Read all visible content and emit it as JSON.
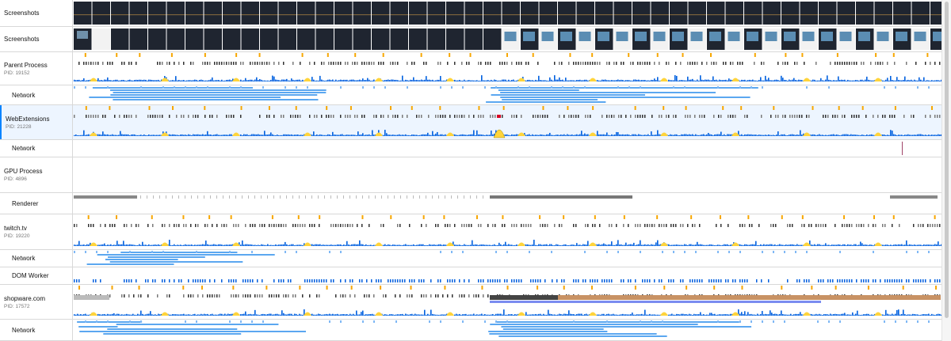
{
  "tracks": [
    {
      "id": "screenshots-1",
      "name": "Screenshots",
      "pid": "",
      "kind": "screenshots",
      "local": false,
      "selected": false
    },
    {
      "id": "screenshots-2",
      "name": "Screenshots",
      "pid": "",
      "kind": "screenshots2",
      "local": false,
      "selected": false
    },
    {
      "id": "parent-process",
      "name": "Parent Process",
      "pid": "PID: 19152",
      "kind": "process",
      "local": false,
      "selected": false
    },
    {
      "id": "parent-network",
      "name": "Network",
      "pid": "",
      "kind": "network",
      "local": true,
      "selected": false
    },
    {
      "id": "webextensions",
      "name": "WebExtensions",
      "pid": "PID: 21228",
      "kind": "process",
      "local": false,
      "selected": true
    },
    {
      "id": "webext-network",
      "name": "Network",
      "pid": "",
      "kind": "network-empty",
      "local": true,
      "selected": false
    },
    {
      "id": "gpu-process",
      "name": "GPU Process",
      "pid": "PID: 4896",
      "kind": "empty",
      "local": false,
      "selected": false
    },
    {
      "id": "gpu-renderer",
      "name": "Renderer",
      "pid": "",
      "kind": "renderer",
      "local": true,
      "selected": false
    },
    {
      "id": "twitch",
      "name": "twitch.tv",
      "pid": "PID: 19220",
      "kind": "process",
      "local": false,
      "selected": false
    },
    {
      "id": "twitch-network",
      "name": "Network",
      "pid": "",
      "kind": "network-small",
      "local": true,
      "selected": false
    },
    {
      "id": "twitch-dom-worker",
      "name": "DOM Worker",
      "pid": "",
      "kind": "worker",
      "local": true,
      "selected": false
    },
    {
      "id": "shopware",
      "name": "shopware.com",
      "pid": "PID: 17572",
      "kind": "process",
      "local": false,
      "selected": false
    },
    {
      "id": "shopware-network",
      "name": "Network",
      "pid": "",
      "kind": "network",
      "local": true,
      "selected": false
    }
  ],
  "colors": {
    "marker": "#f7a600",
    "activity": "#0060df",
    "network": "#5ba7f0",
    "cpu": "#ffd43b",
    "screenshotDark": "#1f2530",
    "selected": "#edf5ff",
    "jank": "#d70022",
    "gc": "#c89264"
  }
}
